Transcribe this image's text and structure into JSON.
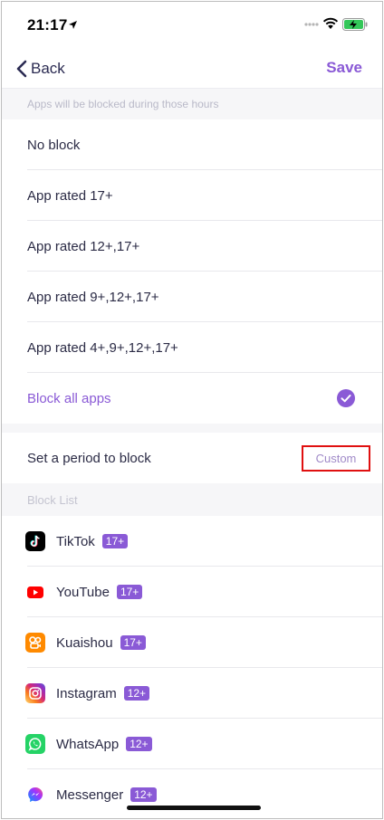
{
  "status_bar": {
    "time": "21:17"
  },
  "nav": {
    "back_label": "Back",
    "save_label": "Save"
  },
  "hours_section": {
    "header": "Apps will be blocked during those hours",
    "options": [
      {
        "label": "No block",
        "selected": false
      },
      {
        "label": "App rated 17+",
        "selected": false
      },
      {
        "label": "App rated 12+,17+",
        "selected": false
      },
      {
        "label": "App rated 9+,12+,17+",
        "selected": false
      },
      {
        "label": "App rated 4+,9+,12+,17+",
        "selected": false
      },
      {
        "label": "Block all apps",
        "selected": true
      }
    ]
  },
  "period": {
    "label": "Set a period to block",
    "value": "Custom"
  },
  "block_list": {
    "header": "Block List",
    "apps": [
      {
        "name": "TikTok",
        "rating": "17+",
        "icon": "tiktok-icon"
      },
      {
        "name": "YouTube",
        "rating": "17+",
        "icon": "youtube-icon"
      },
      {
        "name": "Kuaishou",
        "rating": "17+",
        "icon": "kuaishou-icon"
      },
      {
        "name": "Instagram",
        "rating": "12+",
        "icon": "instagram-icon"
      },
      {
        "name": "WhatsApp",
        "rating": "12+",
        "icon": "whatsapp-icon"
      },
      {
        "name": "Messenger",
        "rating": "12+",
        "icon": "messenger-icon"
      }
    ]
  },
  "colors": {
    "accent": "#8a5ad6",
    "highlight_border": "#e01010",
    "section_bg": "#f6f6f8"
  }
}
